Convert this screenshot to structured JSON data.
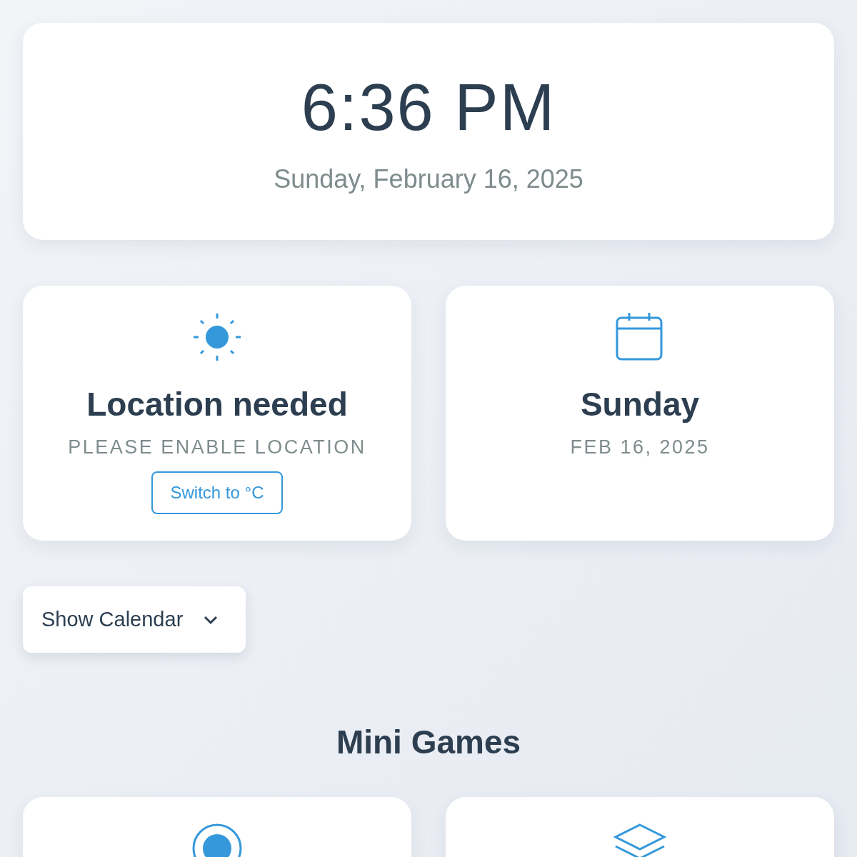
{
  "clock": {
    "time": "6:36 PM",
    "date": "Sunday, February 16, 2025"
  },
  "info_cards": [
    {
      "kind": "weather",
      "title": "Location needed",
      "subtitle": "PLEASE ENABLE LOCATION",
      "button": "Switch to °C"
    },
    {
      "kind": "calendar",
      "title": "Sunday",
      "subtitle": "FEB 16, 2025"
    }
  ],
  "calendar_toggle": {
    "label": "Show Calendar",
    "expanded": false
  },
  "section_title": "Mini Games",
  "games": [
    {
      "kind": "target"
    },
    {
      "kind": "layers"
    }
  ]
}
